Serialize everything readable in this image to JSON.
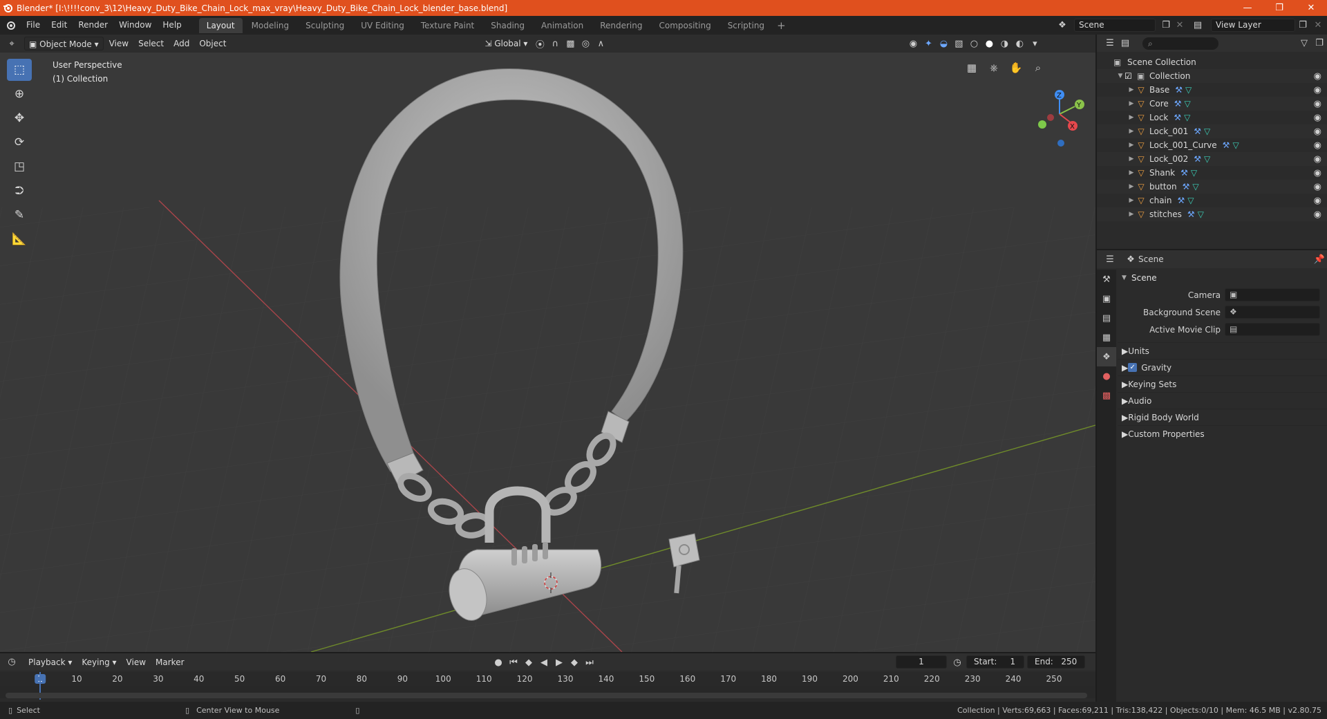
{
  "window": {
    "title": "Blender* [I:\\!!!!conv_3\\12\\Heavy_Duty_Bike_Chain_Lock_max_vray\\Heavy_Duty_Bike_Chain_Lock_blender_base.blend]",
    "controls": [
      "—",
      "❐",
      "✕"
    ]
  },
  "menu": [
    "File",
    "Edit",
    "Render",
    "Window",
    "Help"
  ],
  "workspaces": [
    {
      "label": "Layout",
      "active": true
    },
    {
      "label": "Modeling"
    },
    {
      "label": "Sculpting"
    },
    {
      "label": "UV Editing"
    },
    {
      "label": "Texture Paint"
    },
    {
      "label": "Shading"
    },
    {
      "label": "Animation"
    },
    {
      "label": "Rendering"
    },
    {
      "label": "Compositing"
    },
    {
      "label": "Scripting"
    }
  ],
  "scene_selector": "Scene",
  "view_layer": "View Layer",
  "viewport": {
    "mode": "Object Mode",
    "menus": [
      "View",
      "Select",
      "Add",
      "Object"
    ],
    "transform_orientation": "Global",
    "info_line1": "User Perspective",
    "info_line2": "(1) Collection",
    "axes": {
      "z": "Z",
      "y": "Y",
      "x": "X"
    }
  },
  "outliner": {
    "root": "Scene Collection",
    "collection": "Collection",
    "objects": [
      "Base",
      "Core",
      "Lock",
      "Lock_001",
      "Lock_001_Curve",
      "Lock_002",
      "Shank",
      "button",
      "chain",
      "stitches"
    ]
  },
  "properties": {
    "header": "Scene",
    "panel": "Scene",
    "camera_label": "Camera",
    "bg_scene_label": "Background Scene",
    "movie_clip_label": "Active Movie Clip",
    "subpanels": [
      "Units",
      "Gravity",
      "Keying Sets",
      "Audio",
      "Rigid Body World",
      "Custom Properties"
    ]
  },
  "timeline": {
    "menus": [
      "Playback",
      "Keying",
      "View",
      "Marker"
    ],
    "current_frame": "1",
    "start_label": "Start:",
    "start": "1",
    "end_label": "End:",
    "end": "250",
    "ticks": [
      "1",
      "10",
      "20",
      "30",
      "40",
      "50",
      "60",
      "70",
      "80",
      "90",
      "100",
      "110",
      "120",
      "130",
      "140",
      "150",
      "160",
      "170",
      "180",
      "190",
      "200",
      "210",
      "220",
      "230",
      "240",
      "250"
    ]
  },
  "statusbar": {
    "left1": "Select",
    "left2": "Center View to Mouse",
    "right": "Collection | Verts:69,663 | Faces:69,211 | Tris:138,422 | Objects:0/10 | Mem: 46.5 MB | v2.80.75"
  },
  "colors": {
    "accent": "#4772b3",
    "title_bar": "#e0501e",
    "object_icon": "#f0a040",
    "axis_x": "#e5484d",
    "axis_y": "#8bc34a",
    "axis_z": "#3f8ef5"
  }
}
